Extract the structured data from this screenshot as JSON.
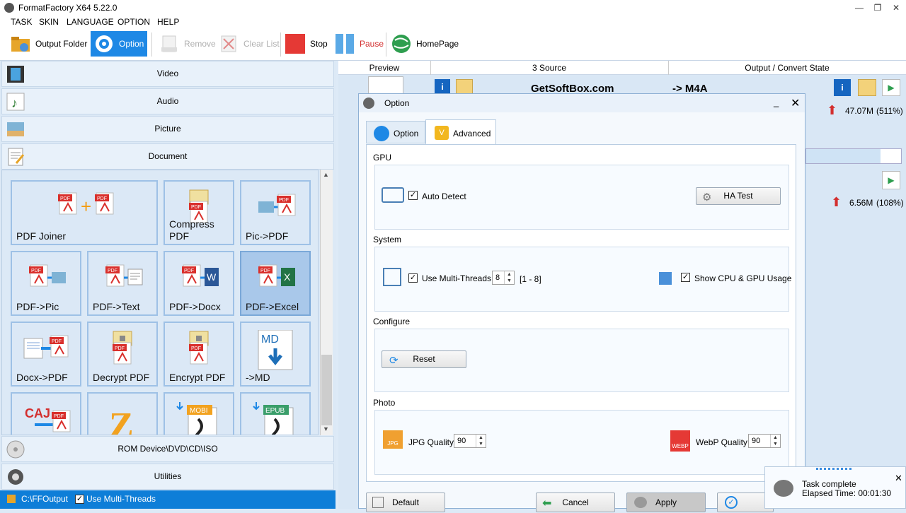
{
  "app": {
    "title": "FormatFactory X64 5.22.0"
  },
  "menu": [
    "TASK",
    "SKIN",
    "LANGUAGE",
    "OPTION",
    "HELP"
  ],
  "toolbar": {
    "output_folder": "Output Folder",
    "option": "Option",
    "remove": "Remove",
    "clear_list": "Clear List",
    "stop": "Stop",
    "pause": "Pause",
    "homepage": "HomePage"
  },
  "categories": {
    "video": "Video",
    "audio": "Audio",
    "picture": "Picture",
    "document": "Document",
    "rom": "ROM Device\\DVD\\CD\\ISO",
    "utilities": "Utilities"
  },
  "tiles": [
    {
      "label": "PDF Joiner",
      "icon": "pdf-joiner-icon"
    },
    {
      "label": "Compress PDF",
      "icon": "compress-pdf-icon"
    },
    {
      "label": "Pic->PDF",
      "icon": "pic-to-pdf-icon"
    },
    {
      "label": "PDF->Pic",
      "icon": "pdf-to-pic-icon"
    },
    {
      "label": "PDF->Text",
      "icon": "pdf-to-text-icon"
    },
    {
      "label": "PDF->Docx",
      "icon": "pdf-to-docx-icon"
    },
    {
      "label": "PDF->Excel",
      "icon": "pdf-to-excel-icon"
    },
    {
      "label": "Docx->PDF",
      "icon": "docx-to-pdf-icon"
    },
    {
      "label": "Decrypt PDF",
      "icon": "decrypt-pdf-icon"
    },
    {
      "label": "Encrypt PDF",
      "icon": "encrypt-pdf-icon"
    },
    {
      "label": "->MD",
      "icon": "to-md-icon"
    },
    {
      "label": "",
      "icon": "caj-to-pdf-icon"
    },
    {
      "label": "",
      "icon": "zip-icon"
    },
    {
      "label": "",
      "icon": "mobi-icon"
    },
    {
      "label": "",
      "icon": "epub-icon"
    }
  ],
  "icon_text": {
    "pdf": "PDF",
    "md": "MD",
    "caj": "CAJ",
    "mobi": "MOBI",
    "epub": "EPUB"
  },
  "status": {
    "folder": "C:\\FFOutput",
    "multithreads": "Use Multi-Threads"
  },
  "task_list": {
    "columns": [
      "Preview",
      "3 Source",
      "Output / Convert State"
    ],
    "row1": {
      "source": "GetSoftBox.com",
      "output": "-> M4A",
      "size": "47.07M",
      "ratio": "(511%)"
    },
    "row2": {
      "size": "6.56M",
      "ratio": "(108%)"
    }
  },
  "dialog": {
    "title": "Option",
    "tabs": [
      "Option",
      "Advanced"
    ],
    "gpu": {
      "heading": "GPU",
      "auto_detect": "Auto Detect",
      "ha_test": "HA Test"
    },
    "system": {
      "heading": "System",
      "multithreads": "Use Multi-Threads",
      "threads_value": "8",
      "threads_range": "[1 - 8]",
      "show_usage": "Show CPU & GPU Usage"
    },
    "configure": {
      "heading": "Configure",
      "reset": "Reset"
    },
    "photo": {
      "heading": "Photo",
      "jpg_label": "JPG Quality",
      "jpg_value": "90",
      "jpg_badge": "JPG",
      "webp_label": "WebP Quality",
      "webp_value": "90",
      "webp_badge": "WEBP"
    },
    "footer": {
      "default": "Default",
      "cancel": "Cancel",
      "apply": "Apply"
    }
  },
  "toast": {
    "line1": "Task complete",
    "line2": "Elapsed Time: 00:01:30"
  },
  "colors": {
    "accent": "#0e7ed8",
    "tile_border": "#9ec1e6",
    "pdf_red": "#d9302c"
  }
}
